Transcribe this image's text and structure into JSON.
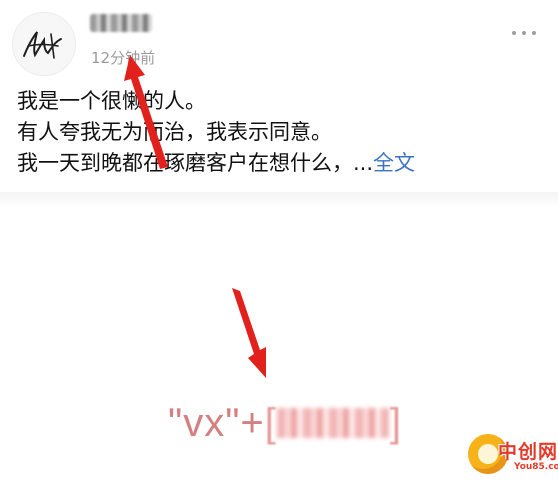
{
  "post": {
    "timestamp": "12分钟前",
    "text_lines": [
      "我是一个很懒的人。",
      "有人夸我无为而治，我表示同意。",
      "我一天到晚都在琢磨客户在想什么，..."
    ],
    "full_text_link": "全文"
  },
  "image": {
    "vx_text": "\"vx\"+",
    "bracket_open": "[",
    "bracket_close": "]"
  },
  "watermark": {
    "name": "中创网",
    "url": "You85.com"
  },
  "colors": {
    "link": "#3b73c2",
    "vx_text": "#d48080",
    "arrow": "#e2201c",
    "timestamp": "#9b9b9b"
  },
  "icons": [
    "more-options-icon",
    "avatar-signature"
  ]
}
